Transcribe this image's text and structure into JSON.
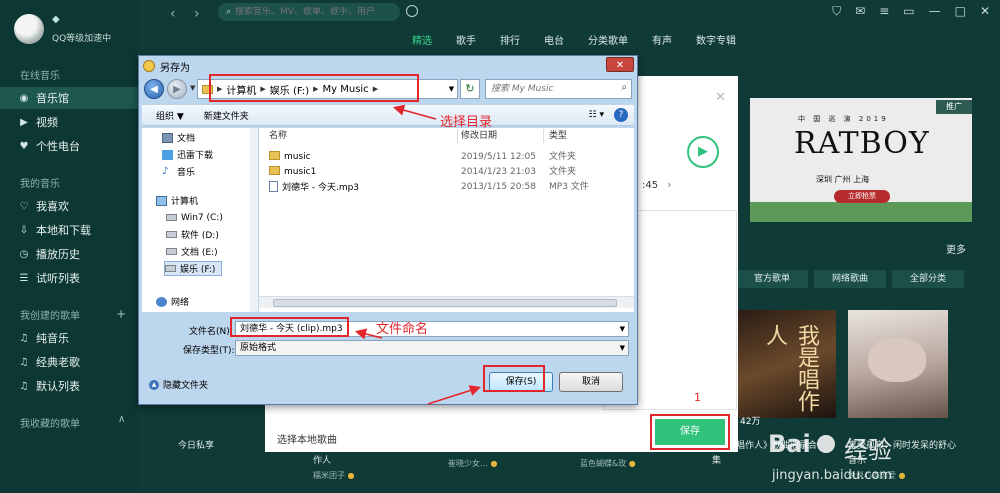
{
  "user": {
    "level_label": "QQ等级加速中"
  },
  "sidebar": {
    "groups": [
      "在线音乐",
      "我的音乐",
      "我创建的歌单",
      "我收藏的歌单"
    ],
    "online": [
      "音乐馆",
      "视频",
      "个性电台"
    ],
    "mine": [
      "我喜欢",
      "本地和下载",
      "播放历史",
      "试听列表"
    ],
    "created": [
      "纯音乐",
      "经典老歌",
      "默认列表"
    ]
  },
  "topbar": {
    "search_placeholder": "搜索音乐、MV、歌单、歌手、用户",
    "tabs": [
      "精选",
      "歌手",
      "排行",
      "电台",
      "分类歌单",
      "有声",
      "数字专辑"
    ]
  },
  "promo": {
    "tag": "推广",
    "small": "中 国 巡 演 2019",
    "title": "RATBOY",
    "cities": "深圳 广州 上海",
    "button": "立即抢票"
  },
  "discover": {
    "more": "更多",
    "categories": [
      "官方歌单",
      "网络歌曲",
      "全部分类"
    ],
    "album_text": "我是唱作人",
    "album_count": "42万",
    "rows": [
      "今日私享",
      "唱作人》歌曲收录合",
      "享受孤寂：闲时发呆的舒心"
    ],
    "rows2": [
      "作人",
      "集",
      "音乐"
    ],
    "subs": [
      "糯米团子",
      "蓝色蝴蝶&玫",
      "说说心态恋爱"
    ],
    "sub_mid": "崔晓少女…"
  },
  "import_panel": {
    "time_label": ":45",
    "hint": "选择本地歌曲",
    "save_button": "保存",
    "step": "1"
  },
  "dialog": {
    "title": "另存为",
    "path": [
      "计算机",
      "娱乐 (F:)",
      "My Music"
    ],
    "search_placeholder": "搜索 My Music",
    "organize": "组织 ▼",
    "new_folder": "新建文件夹",
    "nav": {
      "docs": "文档",
      "xunlei": "迅雷下载",
      "music": "音乐",
      "computer": "计算机",
      "drive_c": "Win7 (C:)",
      "drive_d": "软件 (D:)",
      "drive_e": "文档 (E:)",
      "drive_f": "娱乐 (F:)",
      "network": "网络"
    },
    "columns": [
      "名称",
      "修改日期",
      "类型"
    ],
    "files": [
      {
        "name": "music",
        "date": "2019/5/11 12:05",
        "type": "文件夹"
      },
      {
        "name": "music1",
        "date": "2014/1/23 21:03",
        "type": "文件夹"
      },
      {
        "name": "刘德华 - 今天.mp3",
        "date": "2013/1/15 20:58",
        "type": "MP3 文件"
      }
    ],
    "filename_label": "文件名(N):",
    "filename_value": "刘德华 - 今天 (clip).mp3",
    "filetype_label": "保存类型(T):",
    "filetype_value": "原始格式",
    "hide_folders": "隐藏文件夹",
    "save": "保存(S)",
    "cancel": "取消"
  },
  "annotations": {
    "select_dir": "选择目录",
    "name_file": "文件命名"
  },
  "watermark": {
    "brand": "经验",
    "url": "jingyan.baidu.com"
  },
  "colors": {
    "qq_green": "#31c27c",
    "annotation_red": "#e2262b",
    "app_bg": "#0f3a36"
  }
}
